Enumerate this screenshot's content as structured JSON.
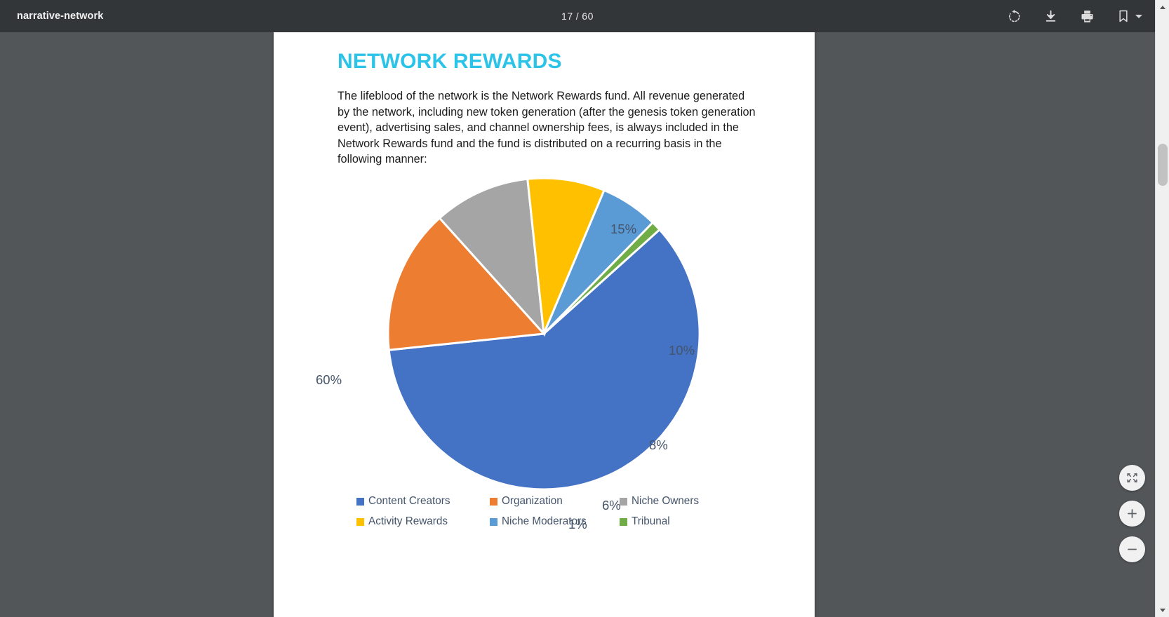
{
  "toolbar": {
    "document_title": "narrative-network",
    "current_page": "17",
    "page_separator": "/",
    "total_pages": "60",
    "rotate_label": "Rotate clockwise",
    "download_label": "Download",
    "print_label": "Print",
    "bookmark_label": "Bookmarks"
  },
  "slide": {
    "title": "NETWORK REWARDS",
    "body": "The lifeblood of the network is the Network Rewards fund. All revenue generated by the network, including new token generation (after the genesis token generation event), advertising sales, and channel ownership fees, is always included in the Network Rewards fund and the fund is distributed on a recurring basis in the following manner:"
  },
  "chart_data": {
    "type": "pie",
    "title": "",
    "categories": [
      "Content Creators",
      "Organization",
      "Niche Owners",
      "Activity Rewards",
      "Niche Moderators",
      "Tribunal"
    ],
    "values": [
      60,
      15,
      10,
      8,
      6,
      1
    ],
    "value_labels": [
      "60%",
      "15%",
      "10%",
      "8%",
      "6%",
      "1%"
    ],
    "colors": [
      "#4472c4",
      "#ed7d31",
      "#a5a5a5",
      "#ffc000",
      "#5b9bd5",
      "#70ad47"
    ],
    "legend_position": "bottom",
    "label_color": "#44546a",
    "start_angle_deg": -42
  },
  "zoom_controls": {
    "fit_label": "Fit to page",
    "zoom_in_label": "Zoom in",
    "zoom_out_label": "Zoom out"
  },
  "scrollbar": {
    "up_label": "Scroll up",
    "down_label": "Scroll down"
  }
}
